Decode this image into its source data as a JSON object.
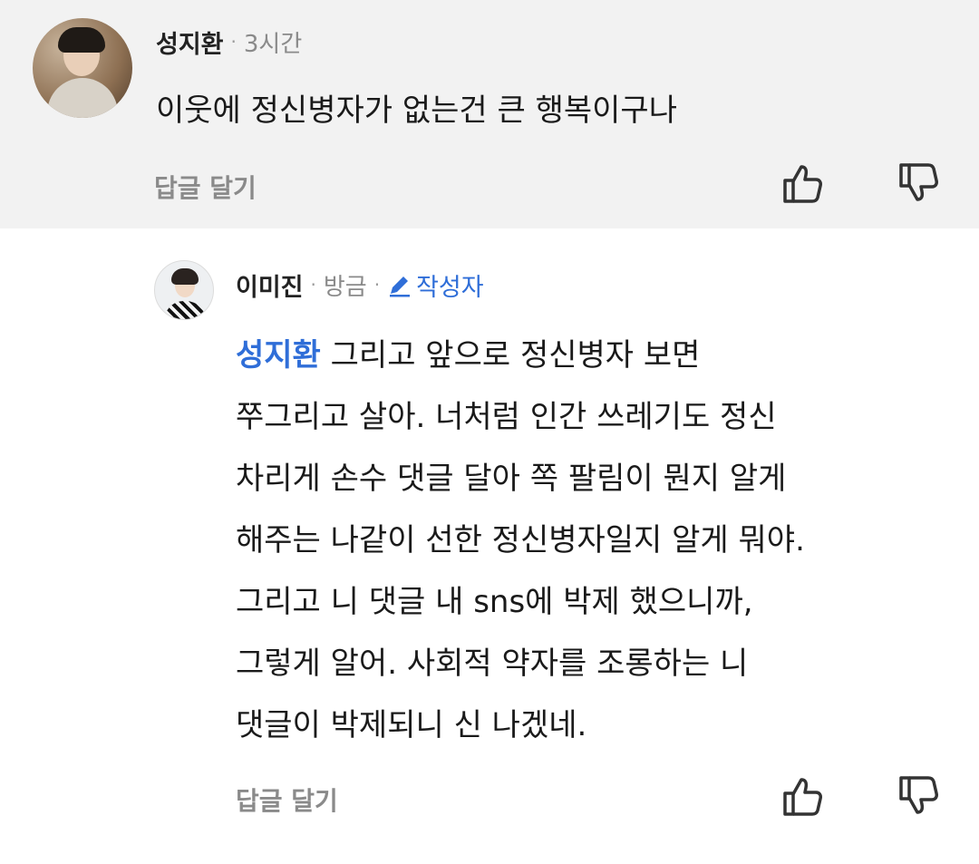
{
  "comment": {
    "author": "성지환",
    "time": "3시간",
    "text": "이웃에 정신병자가 없는건 큰 행복이구나",
    "reply_button": "답글 달기",
    "like_icon": "thumbs-up-icon",
    "dislike_icon": "thumbs-down-icon"
  },
  "reply": {
    "author": "이미진",
    "time": "방금",
    "badge": "작성자",
    "badge_icon": "pencil-icon",
    "mention": "성지환",
    "lines": [
      "그리고 앞으로 정신병자 보면",
      "쭈그리고 살아. 너처럼 인간 쓰레기도 정신",
      "차리게 손수 댓글 달아 쪽 팔림이 뭔지 알게",
      "해주는 나같이 선한 정신병자일지 알게 뭐야.",
      "그리고 니 댓글 내 sns에 박제 했으니까,",
      "그렇게 알어. 사회적 약자를 조롱하는 니",
      "댓글이 박제되니 신 나겠네."
    ],
    "reply_button": "답글 달기",
    "like_icon": "thumbs-up-icon",
    "dislike_icon": "thumbs-down-icon"
  },
  "colors": {
    "top_background": "#f2f2f2",
    "mention": "#2f6ed8",
    "muted": "#8a8a8a"
  }
}
